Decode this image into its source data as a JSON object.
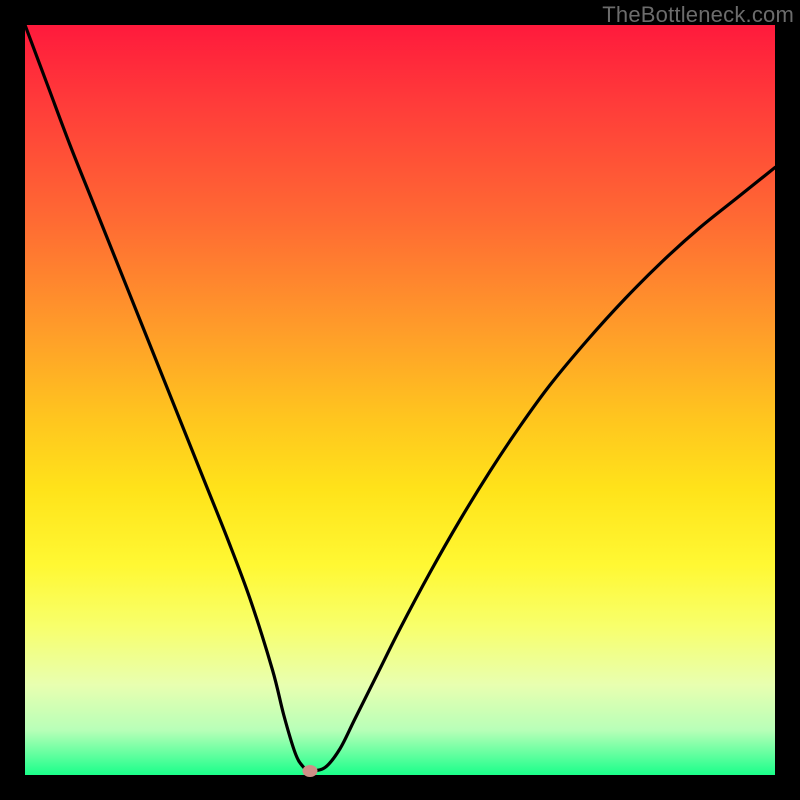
{
  "watermark": "TheBottleneck.com",
  "chart_data": {
    "type": "line",
    "title": "",
    "xlabel": "",
    "ylabel": "",
    "xlim": [
      0,
      100
    ],
    "ylim": [
      0,
      100
    ],
    "grid": false,
    "legend": false,
    "gradient_stops": [
      {
        "pct": 0,
        "color": "#ff1a3c"
      },
      {
        "pct": 10,
        "color": "#ff3a3a"
      },
      {
        "pct": 26,
        "color": "#ff6a33"
      },
      {
        "pct": 40,
        "color": "#ff9a2a"
      },
      {
        "pct": 52,
        "color": "#ffc41f"
      },
      {
        "pct": 62,
        "color": "#ffe31a"
      },
      {
        "pct": 72,
        "color": "#fff833"
      },
      {
        "pct": 80,
        "color": "#f8ff6a"
      },
      {
        "pct": 88,
        "color": "#e8ffb0"
      },
      {
        "pct": 94,
        "color": "#b8ffb8"
      },
      {
        "pct": 100,
        "color": "#1aff8a"
      }
    ],
    "series": [
      {
        "name": "bottleneck-curve",
        "x": [
          0,
          3,
          6,
          9,
          12,
          15,
          18,
          21,
          24,
          27,
          30,
          33,
          34.5,
          36,
          37,
          38,
          40,
          42,
          44,
          47,
          50,
          54,
          58,
          62,
          66,
          70,
          75,
          80,
          85,
          90,
          95,
          100
        ],
        "y": [
          100,
          92,
          84,
          76.5,
          69,
          61.5,
          54,
          46.5,
          39,
          31.5,
          23.5,
          14,
          8,
          3,
          1.2,
          0.6,
          1,
          3.5,
          7.5,
          13.5,
          19.5,
          27,
          34,
          40.5,
          46.5,
          52,
          58,
          63.5,
          68.5,
          73,
          77,
          81
        ]
      }
    ],
    "marker": {
      "x": 38,
      "y": 0.6,
      "color": "#cf8f87"
    }
  }
}
